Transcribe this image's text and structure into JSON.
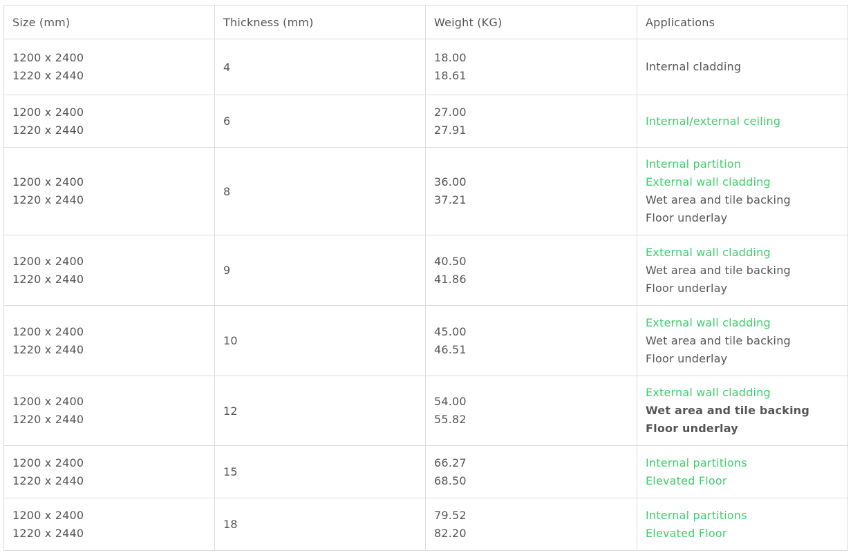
{
  "headers": {
    "size": "Size (mm)",
    "thickness": "Thickness (mm)",
    "weight": "Weight (KG)",
    "applications": "Applications"
  },
  "colors": {
    "link_green": "#3ccf6a",
    "text": "#555555",
    "border": "#dcdcdc"
  },
  "rows": [
    {
      "sizes": [
        "1200 x 2400",
        "1220 x 2440"
      ],
      "thickness": "4",
      "weights": [
        "18.00",
        "18.61"
      ],
      "applications": [
        {
          "text": "Internal cladding",
          "style": "plain"
        }
      ]
    },
    {
      "sizes": [
        "1200 x 2400",
        "1220 x 2440"
      ],
      "thickness": "6",
      "weights": [
        "27.00",
        "27.91"
      ],
      "applications": [
        {
          "text": "Internal/external ceiling",
          "style": "green"
        }
      ]
    },
    {
      "sizes": [
        "1200 x 2400",
        "1220 x 2440"
      ],
      "thickness": "8",
      "weights": [
        "36.00",
        "37.21"
      ],
      "applications": [
        {
          "text": "Internal partition",
          "style": "green"
        },
        {
          "text": "External wall cladding",
          "style": "green"
        },
        {
          "text": "Wet area and tile backing",
          "style": "plain"
        },
        {
          "text": "Floor underlay",
          "style": "plain"
        }
      ]
    },
    {
      "sizes": [
        "1200 x 2400",
        "1220 x 2440"
      ],
      "thickness": "9",
      "weights": [
        "40.50",
        "41.86"
      ],
      "applications": [
        {
          "text": "External wall cladding",
          "style": "green"
        },
        {
          "text": "Wet area and tile backing",
          "style": "plain"
        },
        {
          "text": "Floor underlay",
          "style": "plain"
        }
      ]
    },
    {
      "sizes": [
        "1200 x 2400",
        "1220 x 2440"
      ],
      "thickness": "10",
      "weights": [
        "45.00",
        "46.51"
      ],
      "applications": [
        {
          "text": "External wall cladding",
          "style": "green"
        },
        {
          "text": "Wet area and tile backing",
          "style": "plain"
        },
        {
          "text": "Floor underlay",
          "style": "plain"
        }
      ]
    },
    {
      "sizes": [
        "1200 x 2400",
        "1220 x 2440"
      ],
      "thickness": "12",
      "weights": [
        "54.00",
        "55.82"
      ],
      "applications": [
        {
          "text": "External wall cladding",
          "style": "green"
        },
        {
          "text": "Wet area and tile backing",
          "style": "bold"
        },
        {
          "text": "Floor underlay",
          "style": "bold"
        }
      ]
    },
    {
      "sizes": [
        "1200 x 2400",
        "1220 x 2440"
      ],
      "thickness": "15",
      "weights": [
        "66.27",
        "68.50"
      ],
      "applications": [
        {
          "text": "Internal partitions",
          "style": "green"
        },
        {
          "text": "Elevated Floor",
          "style": "green"
        }
      ]
    },
    {
      "sizes": [
        "1200 x 2400",
        "1220 x 2440"
      ],
      "thickness": "18",
      "weights": [
        "79.52",
        "82.20"
      ],
      "applications": [
        {
          "text": "Internal partitions",
          "style": "green"
        },
        {
          "text": "Elevated Floor",
          "style": "green"
        }
      ]
    }
  ]
}
